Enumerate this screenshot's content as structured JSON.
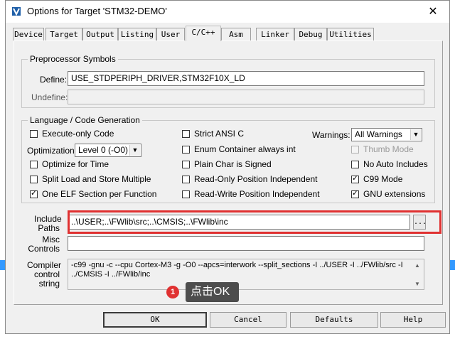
{
  "window": {
    "title": "Options for Target 'STM32-DEMO'",
    "close_glyph": "✕"
  },
  "tabs": [
    {
      "label": "Device"
    },
    {
      "label": "Target"
    },
    {
      "label": "Output"
    },
    {
      "label": "Listing"
    },
    {
      "label": "User"
    },
    {
      "label": "C/C++"
    },
    {
      "label": "Asm"
    },
    {
      "label": "Linker"
    },
    {
      "label": "Debug"
    },
    {
      "label": "Utilities"
    }
  ],
  "active_tab": "C/C++",
  "preprocessor": {
    "title": "Preprocessor Symbols",
    "define_label": "Define:",
    "define_value": "USE_STDPERIPH_DRIVER,STM32F10X_LD",
    "undefine_label": "Undefine:",
    "undefine_value": ""
  },
  "language": {
    "title": "Language / Code Generation",
    "checkboxes": [
      {
        "label": "Execute-only Code",
        "checked": false,
        "enabled": true
      },
      {
        "label": "Optimize for Time",
        "checked": false,
        "enabled": true
      },
      {
        "label": "Split Load and Store Multiple",
        "checked": false,
        "enabled": true
      },
      {
        "label": "One ELF Section per Function",
        "checked": true,
        "enabled": true
      },
      {
        "label": "Strict ANSI C",
        "checked": false,
        "enabled": true
      },
      {
        "label": "Enum Container always int",
        "checked": false,
        "enabled": true
      },
      {
        "label": "Plain Char is Signed",
        "checked": false,
        "enabled": true
      },
      {
        "label": "Read-Only Position Independent",
        "checked": false,
        "enabled": true
      },
      {
        "label": "Read-Write Position Independent",
        "checked": false,
        "enabled": true
      },
      {
        "label": "Thumb Mode",
        "checked": false,
        "enabled": false
      },
      {
        "label": "No Auto Includes",
        "checked": false,
        "enabled": true
      },
      {
        "label": "C99 Mode",
        "checked": true,
        "enabled": true
      },
      {
        "label": "GNU extensions",
        "checked": true,
        "enabled": true
      }
    ],
    "optimization_label": "Optimization:",
    "optimization_value": "Level 0 (-O0)",
    "warnings_label": "Warnings:",
    "warnings_value": "All Warnings"
  },
  "include": {
    "label_line1": "Include",
    "label_line2": "Paths",
    "value": "..\\USER;..\\FWlib\\src;..\\CMSIS;..\\FWlib\\inc",
    "browse_label": "..."
  },
  "misc": {
    "label_line1": "Misc",
    "label_line2": "Controls",
    "value": ""
  },
  "compiler": {
    "label_line1": "Compiler",
    "label_line2": "control",
    "label_line3": "string",
    "line1": "-c99 -gnu -c --cpu Cortex-M3 -g -O0 --apcs=interwork --split_sections -I ../USER -I ../FWlib/src -I",
    "line2": "../CMSIS -I ../FWlib/inc"
  },
  "buttons": {
    "ok": "OK",
    "cancel": "Cancel",
    "defaults": "Defaults",
    "help": "Help"
  },
  "annotation": {
    "step": "1",
    "text": "点击OK"
  },
  "colors": {
    "highlight": "#e03131",
    "tooltip_bg": "#4d4d4d",
    "dialog_bg": "#f0f0f0"
  }
}
